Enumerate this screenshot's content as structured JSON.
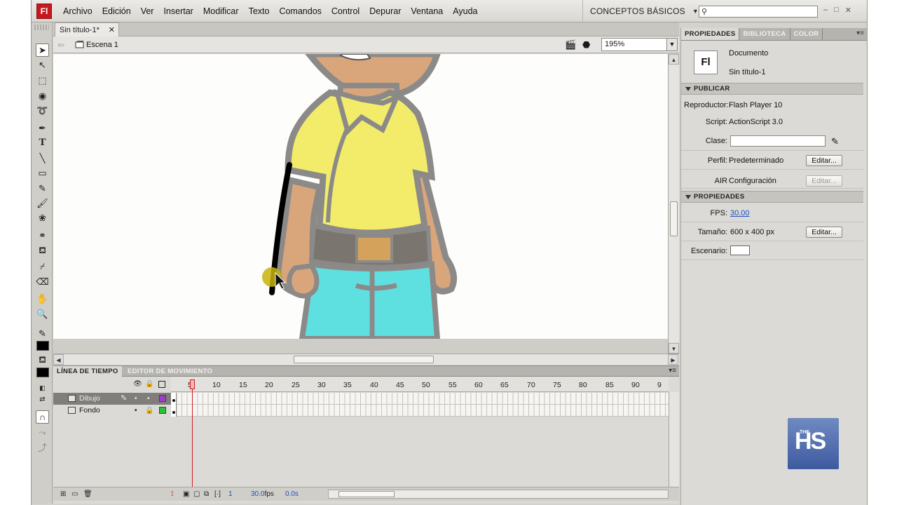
{
  "app": {
    "logo": "Fl"
  },
  "menu": [
    "Archivo",
    "Edición",
    "Ver",
    "Insertar",
    "Modificar",
    "Texto",
    "Comandos",
    "Control",
    "Depurar",
    "Ventana",
    "Ayuda"
  ],
  "workspace": "CONCEPTOS BÁSICOS",
  "search": {
    "placeholder": ""
  },
  "document": {
    "tab": "Sin título-1*",
    "scene": "Escena 1",
    "zoom": "195%"
  },
  "properties": {
    "tabs": [
      "PROPIEDADES",
      "BIBLIOTECA",
      "COLOR"
    ],
    "doc_icon": "Fl",
    "doc_type": "Documento",
    "doc_name": "Sin título-1",
    "publish": {
      "title": "PUBLICAR",
      "player_label": "Reproductor:",
      "player_value": "Flash Player 10",
      "script_label": "Script:",
      "script_value": "ActionScript 3.0",
      "class_label": "Clase:",
      "profile_label": "Perfil:",
      "profile_value": "Predeterminado",
      "air_label": "AIR",
      "air_value": "Configuración",
      "edit": "Editar..."
    },
    "props": {
      "title": "PROPIEDADES",
      "fps_label": "FPS:",
      "fps_value": "30.00",
      "size_label": "Tamaño:",
      "size_value": "600 x 400 px",
      "stage_label": "Escenario:",
      "stage_color": "#ffffff",
      "edit": "Editar..."
    }
  },
  "timeline": {
    "tabs": [
      "LÍNEA DE TIEMPO",
      "EDITOR DE MOVIMIENTO"
    ],
    "frame_numbers": [
      "5",
      "10",
      "15",
      "20",
      "25",
      "30",
      "35",
      "40",
      "45",
      "50",
      "55",
      "60",
      "65",
      "70",
      "75",
      "80",
      "85",
      "90",
      "9"
    ],
    "layers": [
      {
        "name": "Dibujo",
        "color": "#9b3fc6",
        "selected": true
      },
      {
        "name": "Fondo",
        "color": "#27c23a",
        "selected": false
      }
    ],
    "status": {
      "frame": "1",
      "fps": "30.0",
      "fps_unit": "fps",
      "time": "0.0s"
    }
  },
  "watermark": {
    "the": "THE",
    "text": "HS"
  },
  "colors": {
    "accent": "#c8171e",
    "playhead": "#d31c22",
    "shirt": "#f2ec6a",
    "pants": "#5fe0e0",
    "skin": "#d9a67c",
    "outline": "#8c8a88"
  }
}
